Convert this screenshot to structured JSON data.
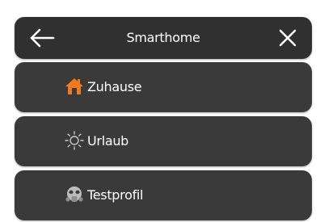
{
  "header": {
    "title": "Smarthome",
    "back_icon": "arrow-left-icon",
    "close_icon": "close-icon"
  },
  "profiles": [
    {
      "label": "Zuhause",
      "icon": "home-icon",
      "icon_color": "#f07a1e"
    },
    {
      "label": "Urlaub",
      "icon": "sun-icon",
      "icon_color": "#c8c8c8"
    },
    {
      "label": "Testprofil",
      "icon": "gas-mask-icon",
      "icon_color": "#c8c8c8"
    }
  ],
  "colors": {
    "panel_background": "#303030",
    "item_background": "#3a3a3a",
    "text": "#ffffff",
    "accent": "#f07a1e"
  }
}
